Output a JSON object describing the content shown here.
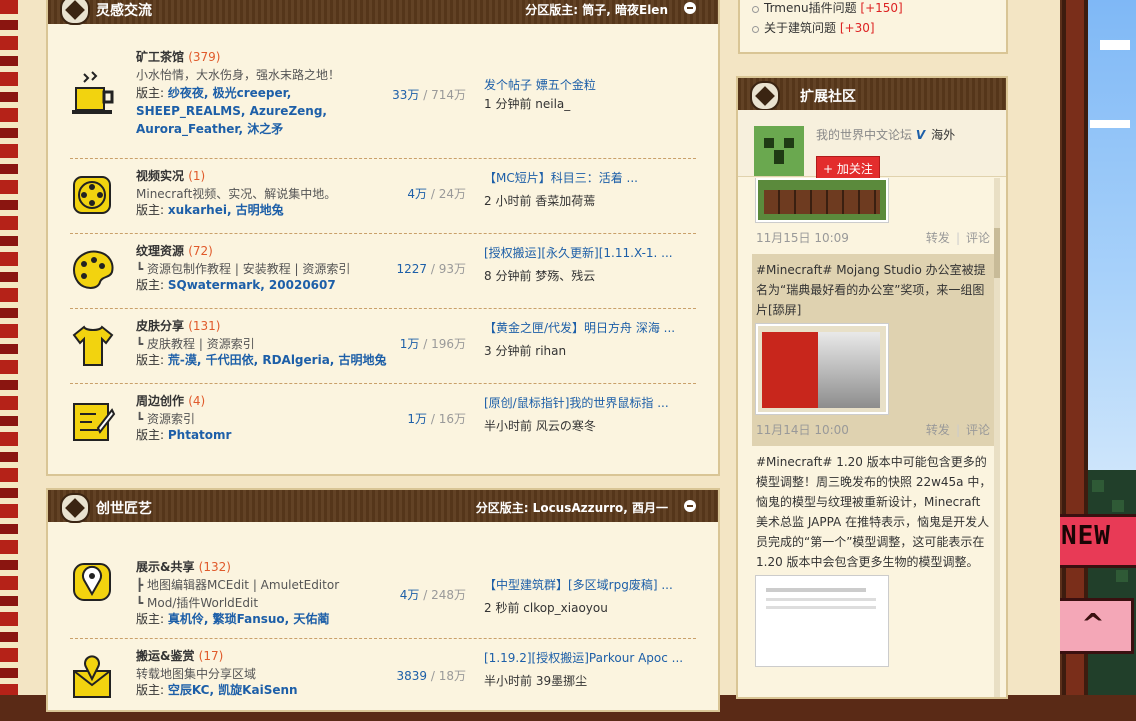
{
  "section1": {
    "title": "灵感交流",
    "moderators": "分区版主: 筒子, 暗夜Elen",
    "forums": [
      {
        "name": "矿工茶馆",
        "count": "(379)",
        "desc": "小水怡情，大水伤身，强水末路之地！",
        "mods_label": "版主:",
        "mods": "纱夜夜, 极光creeper, SHEEP_REALMS, AzureZeng, Aurora_Feather, 沐之矛",
        "threads": "33万",
        "posts": "714万",
        "last_title": "发个帖子 嫖五个金粒",
        "last_meta": "1 分钟前 neila_",
        "icon": "teacup-icon"
      },
      {
        "name": "视频实况",
        "count": "(1)",
        "desc": "Minecraft视频、实况、解说集中地。",
        "mods_label": "版主:",
        "mods": "xukarhei, 古明地兔",
        "threads": "4万",
        "posts": "24万",
        "last_title": "【MC短片】科目三：活着 ...",
        "last_meta": "2 小时前 香菜加荷蔫",
        "icon": "film-reel-icon"
      },
      {
        "name": "纹理资源",
        "count": "(72)",
        "desc": "┗ 资源包制作教程 | 安装教程 | 资源索引",
        "mods_label": "版主:",
        "mods": "SQwatermark, 20020607",
        "threads": "1227",
        "posts": "93万",
        "last_title": "[授权搬运][永久更新][1.11.X-1. ...",
        "last_meta": "8 分钟前 梦殇、残云",
        "icon": "palette-icon"
      },
      {
        "name": "皮肤分享",
        "count": "(131)",
        "desc": "┗ 皮肤教程 | 资源索引",
        "mods_label": "版主:",
        "mods": "荒-漠, 千代田依, RDAlgeria, 古明地兔",
        "threads": "1万",
        "posts": "196万",
        "last_title": "【黄金之匣/代发】明日方舟 深海 ...",
        "last_meta": "3 分钟前 rihan",
        "icon": "shirt-icon"
      },
      {
        "name": "周边创作",
        "count": "(4)",
        "desc": "┗ 资源索引",
        "mods_label": "版主:",
        "mods": "Phtatomr",
        "threads": "1万",
        "posts": "16万",
        "last_title": "[原创/鼠标指针]我的世界鼠标指 ...",
        "last_meta": "半小时前 风云の寒冬",
        "icon": "pencil-paper-icon"
      }
    ]
  },
  "section2": {
    "title": "创世匠艺",
    "moderators": "分区版主: LocusAzzurro, 酉月一",
    "forums": [
      {
        "name": "展示&共享",
        "count": "(132)",
        "desc1": "┣ 地图编辑器MCEdit | AmuletEditor",
        "desc2": "┗ Mod/插件WorldEdit",
        "mods_label": "版主:",
        "mods": "真机伶, 繁琐Fansuo, 天佑蔺",
        "threads": "4万",
        "posts": "248万",
        "last_title": "【中型建筑群】[多区域rpg废稿] ...",
        "last_meta": "2 秒前 clkop_xiaoyou",
        "icon": "map-pin-icon"
      },
      {
        "name": "搬运&鉴赏",
        "count": "(17)",
        "desc": "转载地图集中分享区域",
        "mods_label": "版主:",
        "mods": "空辰KC, 凯旋KaiSenn",
        "threads": "3839",
        "posts": "18万",
        "last_title": "[1.19.2][授权搬运]Parkour Apoc ...",
        "last_meta": "半小时前 39墨挪尘",
        "icon": "location-envelope-icon"
      }
    ]
  },
  "side_top": {
    "items": [
      {
        "label": "Trmenu插件问题",
        "plus": "[+150]"
      },
      {
        "label": "关于建筑问题",
        "plus": "[+30]"
      }
    ]
  },
  "ext": {
    "title": "扩展社区",
    "weibo_name": "我的世界中文论坛",
    "weibo_v": "V",
    "weibo_loc": "海外",
    "follow_label": "+ 加关注",
    "posts": [
      {
        "text": "",
        "meta_time": "11月15日 10:09",
        "repost": "转发",
        "comment": "评论"
      },
      {
        "text": "#Minecraft# Mojang Studio 办公室被提名为“瑞典最好看的办公室”奖项，来一组图片[舔屏]",
        "meta_time": "11月14日 10:00",
        "repost": "转发",
        "comment": "评论"
      },
      {
        "text": "#Minecraft# 1.20 版本中可能包含更多的模型调整！周三晚发布的快照 22w45a 中，恼鬼的模型与纹理被重新设计，Minecraft 美术总监 JAPPA 在推特表示，恼鬼是开发人员完成的“第一个”模型调整，这可能表示在 1.20 版本中会包含更多生物的模型调整。"
      }
    ]
  },
  "badges": {
    "new": "NEW",
    "up": "^"
  },
  "colors": {
    "accent_link": "#1d5fa8",
    "count_orange": "#e05a2b",
    "header_brown": "#5c3a1c"
  }
}
